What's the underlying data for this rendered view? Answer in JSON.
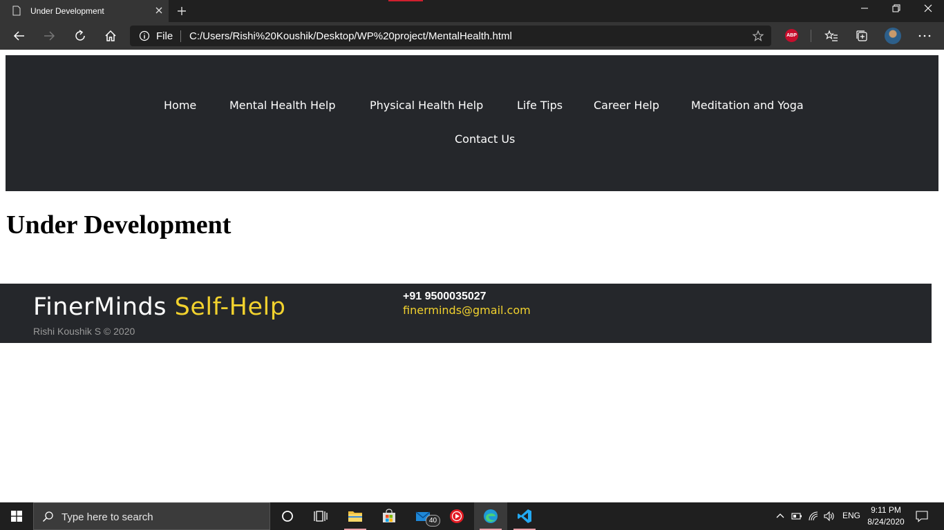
{
  "browser": {
    "tab_title": "Under Development",
    "address": {
      "scheme_label": "File",
      "url": "C:/Users/Rishi%20Koushik/Desktop/WP%20project/MentalHealth.html"
    },
    "extension_label": "ABP"
  },
  "site": {
    "nav": {
      "items": [
        {
          "label": "Home"
        },
        {
          "label": "Mental Health Help"
        },
        {
          "label": "Physical Health Help"
        },
        {
          "label": "Life Tips"
        },
        {
          "label": "Career Help"
        },
        {
          "label": "Meditation and Yoga"
        },
        {
          "label": "Contact Us"
        }
      ]
    },
    "heading": "Under Development",
    "footer": {
      "brand_part1": "FinerMinds",
      "brand_part2": "Self-Help",
      "copyright": "Rishi Koushik S © 2020",
      "phone": "+91 9500035027",
      "email": "finerminds@gmail.com"
    },
    "colors": {
      "nav_bg": "#25272b",
      "accent_yellow": "#f2d22e"
    }
  },
  "taskbar": {
    "search_placeholder": "Type here to search",
    "mail_badge": "40",
    "language": "ENG",
    "time": "9:11 PM",
    "date": "8/24/2020"
  }
}
